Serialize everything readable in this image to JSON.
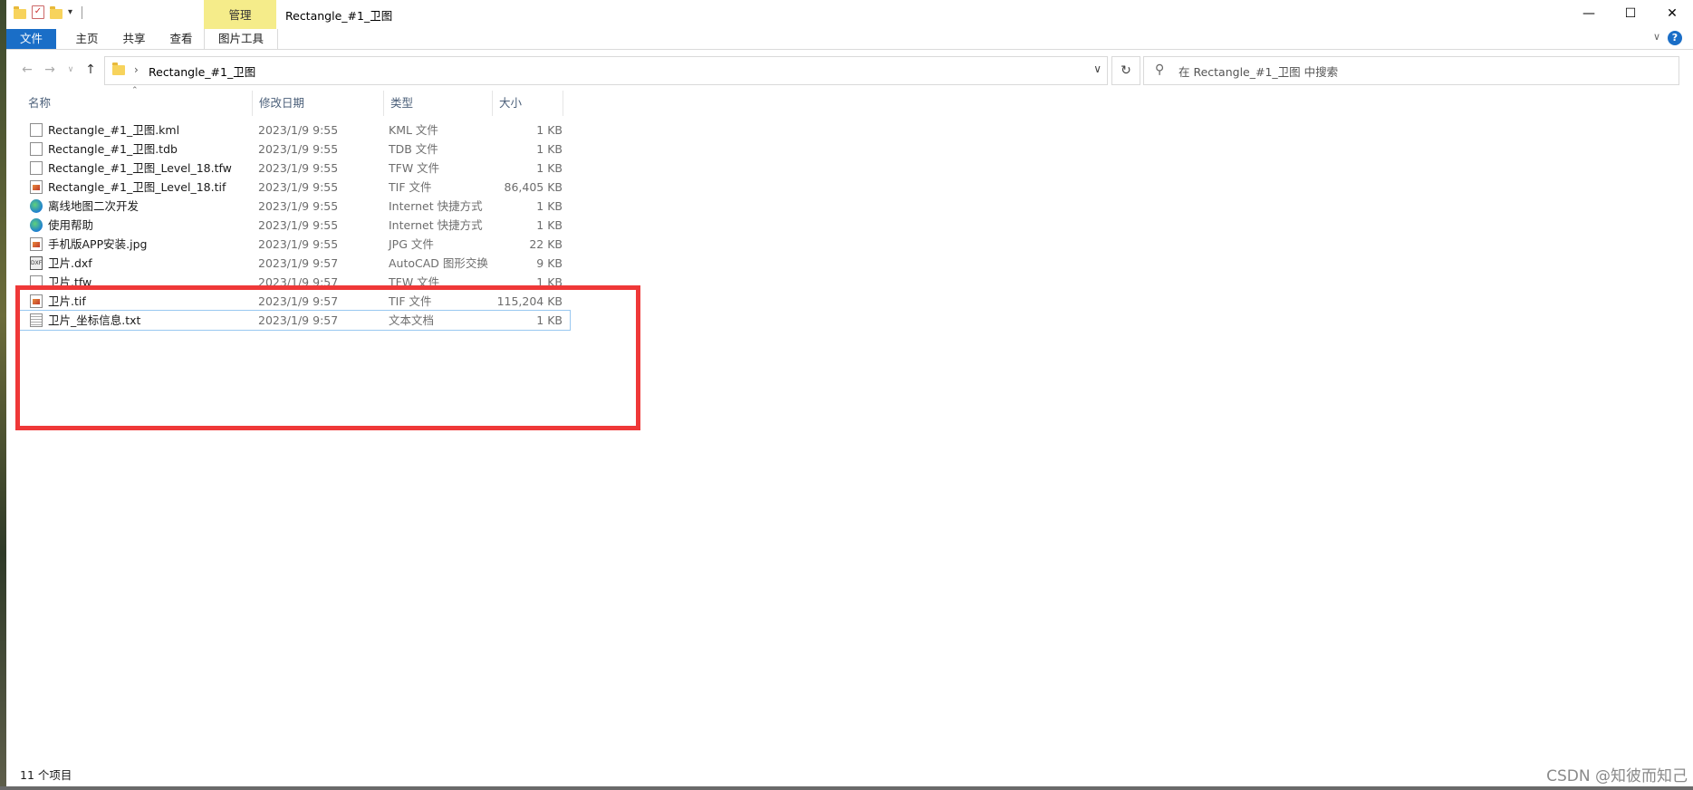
{
  "window": {
    "title": "Rectangle_#1_卫图",
    "context_tab_group": "管理"
  },
  "ribbon": {
    "tabs": [
      "文件",
      "主页",
      "共享",
      "查看"
    ],
    "context_tab": "图片工具"
  },
  "nav": {
    "breadcrumb": "Rectangle_#1_卫图",
    "search_placeholder": "在 Rectangle_#1_卫图 中搜索"
  },
  "columns": {
    "name": "名称",
    "date": "修改日期",
    "type": "类型",
    "size": "大小"
  },
  "files": [
    {
      "name": "Rectangle_#1_卫图.kml",
      "date": "2023/1/9 9:55",
      "type": "KML 文件",
      "size": "1 KB",
      "icon": "document-icon"
    },
    {
      "name": "Rectangle_#1_卫图.tdb",
      "date": "2023/1/9 9:55",
      "type": "TDB 文件",
      "size": "1 KB",
      "icon": "document-icon"
    },
    {
      "name": "Rectangle_#1_卫图_Level_18.tfw",
      "date": "2023/1/9 9:55",
      "type": "TFW 文件",
      "size": "1 KB",
      "icon": "document-icon"
    },
    {
      "name": "Rectangle_#1_卫图_Level_18.tif",
      "date": "2023/1/9 9:55",
      "type": "TIF 文件",
      "size": "86,405 KB",
      "icon": "image-file-icon"
    },
    {
      "name": "离线地图二次开发",
      "date": "2023/1/9 9:55",
      "type": "Internet 快捷方式",
      "size": "1 KB",
      "icon": "edge-shortcut-icon"
    },
    {
      "name": "使用帮助",
      "date": "2023/1/9 9:55",
      "type": "Internet 快捷方式",
      "size": "1 KB",
      "icon": "edge-shortcut-icon"
    },
    {
      "name": "手机版APP安装.jpg",
      "date": "2023/1/9 9:55",
      "type": "JPG 文件",
      "size": "22 KB",
      "icon": "image-file-icon"
    },
    {
      "name": "卫片.dxf",
      "date": "2023/1/9 9:57",
      "type": "AutoCAD 图形交换",
      "size": "9 KB",
      "icon": "dxf-file-icon"
    },
    {
      "name": "卫片.tfw",
      "date": "2023/1/9 9:57",
      "type": "TFW 文件",
      "size": "1 KB",
      "icon": "document-icon"
    },
    {
      "name": "卫片.tif",
      "date": "2023/1/9 9:57",
      "type": "TIF 文件",
      "size": "115,204 KB",
      "icon": "image-file-icon"
    },
    {
      "name": "卫片_坐标信息.txt",
      "date": "2023/1/9 9:57",
      "type": "文本文档",
      "size": "1 KB",
      "icon": "text-file-icon"
    }
  ],
  "status": {
    "item_count": "11 个项目"
  },
  "watermark": "CSDN @知彼而知己",
  "colors": {
    "file_tab": "#1a6ec7",
    "context_tab": "#f5ec8a",
    "highlight_box": "#ef3838",
    "selection_border": "#99c8f0"
  }
}
